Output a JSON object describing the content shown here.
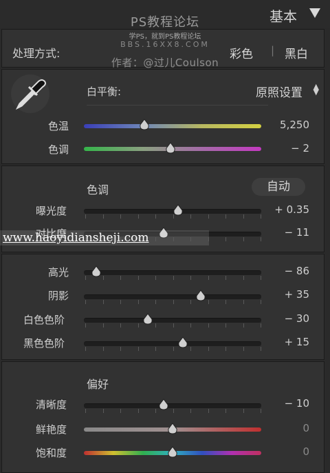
{
  "panel": {
    "title": "基本"
  },
  "watermark": {
    "line1": "PS教程论坛",
    "line2": "学PS，就到PS教程论坛",
    "line3": "BBS.16XX8.COM",
    "line4": "作者：@过儿Coulson"
  },
  "treatment": {
    "label": "处理方式:",
    "color": "彩色",
    "bw": "黑白"
  },
  "white_balance": {
    "label": "白平衡:",
    "value": "原照设置"
  },
  "temp": {
    "label": "色温",
    "value": "5,250",
    "position": 0.34
  },
  "tint": {
    "label": "色调",
    "value": "− 2",
    "position": 0.49
  },
  "tone": {
    "heading": "色调",
    "auto": "自动"
  },
  "exposure": {
    "label": "曝光度",
    "value": "+ 0.35",
    "position": 0.53
  },
  "contrast": {
    "label": "对比度",
    "value": "− 11",
    "position": 0.45
  },
  "highlights": {
    "label": "高光",
    "value": "− 86",
    "position": 0.07
  },
  "shadows": {
    "label": "阴影",
    "value": "+ 35",
    "position": 0.66
  },
  "whites": {
    "label": "白色色阶",
    "value": "− 30",
    "position": 0.36
  },
  "blacks": {
    "label": "黑色色阶",
    "value": "+ 15",
    "position": 0.56
  },
  "presence": {
    "heading": "偏好"
  },
  "clarity": {
    "label": "清晰度",
    "value": "− 10",
    "position": 0.45
  },
  "vibrance": {
    "label": "鲜艳度",
    "value": "0",
    "position": 0.5
  },
  "saturation": {
    "label": "饱和度",
    "value": "0",
    "position": 0.5
  },
  "url": "www.haoyidiansheji.com"
}
